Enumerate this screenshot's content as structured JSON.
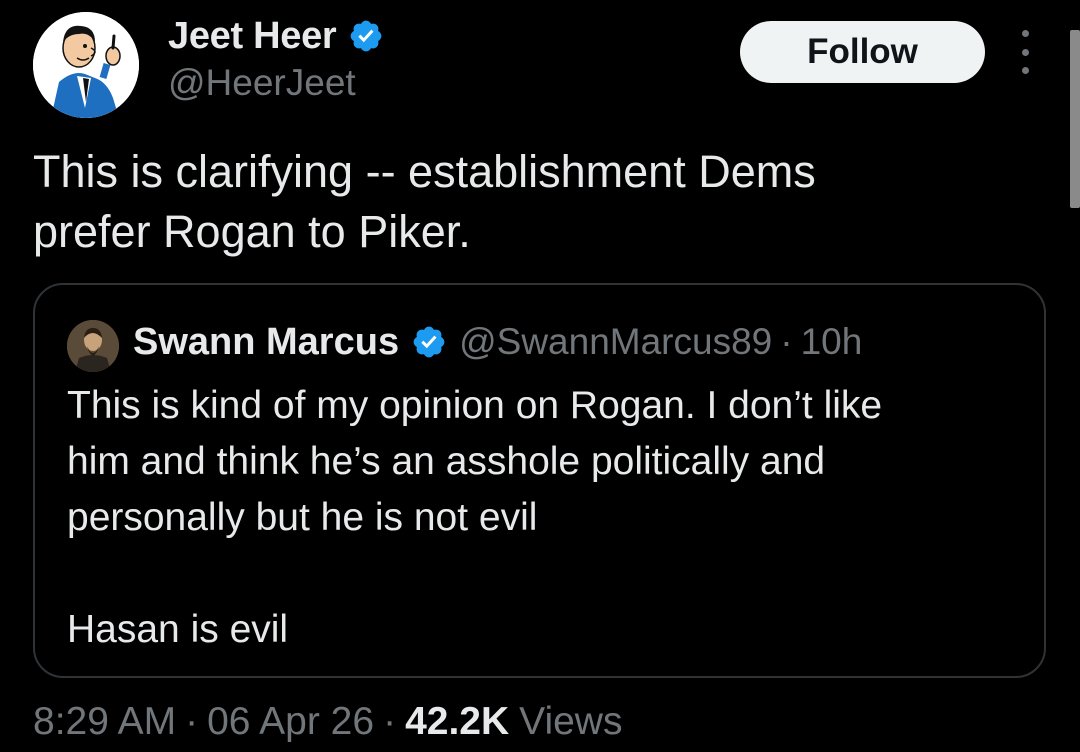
{
  "author": {
    "name": "Jeet Heer",
    "handle": "@HeerJeet",
    "avatar_icon": "cartoon-man-avatar",
    "verified_icon": "verified-badge-icon"
  },
  "header": {
    "follow_label": "Follow",
    "more_icon": "more-options-icon"
  },
  "tweet": {
    "text": "This is clarifying -- establishment Dems\nprefer Rogan to Piker."
  },
  "quote": {
    "name": "Swann Marcus",
    "handle": "@SwannMarcus89",
    "separator": "·",
    "time": "10h",
    "text": "This is kind of my opinion on Rogan. I don’t like\nhim and think he’s an asshole politically and\npersonally but he is not evil\n\nHasan is evil",
    "avatar_icon": "portrait-avatar"
  },
  "meta": {
    "time": "8:29 AM",
    "separator": "·",
    "date": "06 Apr 26",
    "views_count": "42.2K",
    "views_label": "Views"
  },
  "colors": {
    "background": "#000000",
    "text_primary": "#e7e9ea",
    "text_secondary": "#71767b",
    "verified_blue": "#1d9bf0",
    "follow_bg": "#eff3f4",
    "border": "#2f3336"
  }
}
